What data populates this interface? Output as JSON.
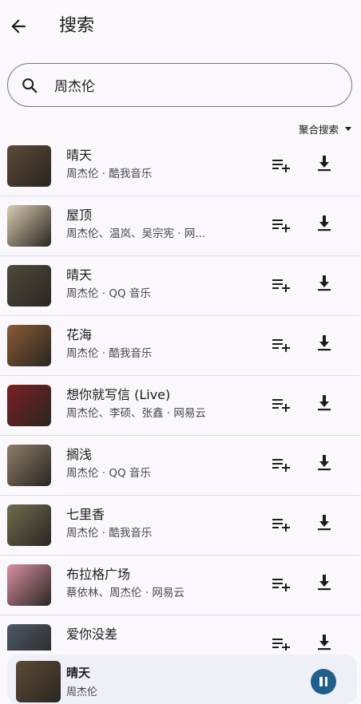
{
  "header": {
    "title": "搜索"
  },
  "search": {
    "value": "周杰伦"
  },
  "filter": {
    "label": "聚合搜索"
  },
  "songs": [
    {
      "title": "晴天",
      "subtitle": "周杰伦 · 酷我音乐",
      "cover_color": "#5c4a36"
    },
    {
      "title": "屋顶",
      "subtitle": "周杰伦、温岚、吴宗宪 · 网...",
      "cover_color": "#d8cbb0"
    },
    {
      "title": "晴天",
      "subtitle": "周杰伦 · QQ 音乐",
      "cover_color": "#4d4a3a"
    },
    {
      "title": "花海",
      "subtitle": "周杰伦 · 酷我音乐",
      "cover_color": "#8a5a34"
    },
    {
      "title": "想你就写信 (Live)",
      "subtitle": "周杰伦、李硕、张鑫 · 网易云",
      "cover_color": "#7a1f22"
    },
    {
      "title": "搁浅",
      "subtitle": "周杰伦 · QQ 音乐",
      "cover_color": "#8d7d68"
    },
    {
      "title": "七里香",
      "subtitle": "周杰伦 · 酷我音乐",
      "cover_color": "#6f6c4d"
    },
    {
      "title": "布拉格广场",
      "subtitle": "蔡依林、周杰伦 · 网易云",
      "cover_color": "#d88fa0"
    },
    {
      "title": "爱你没差",
      "subtitle": "",
      "cover_color": "#4c5866"
    }
  ],
  "player": {
    "title": "晴天",
    "artist": "周杰伦",
    "accent": "#1f5f8a"
  }
}
